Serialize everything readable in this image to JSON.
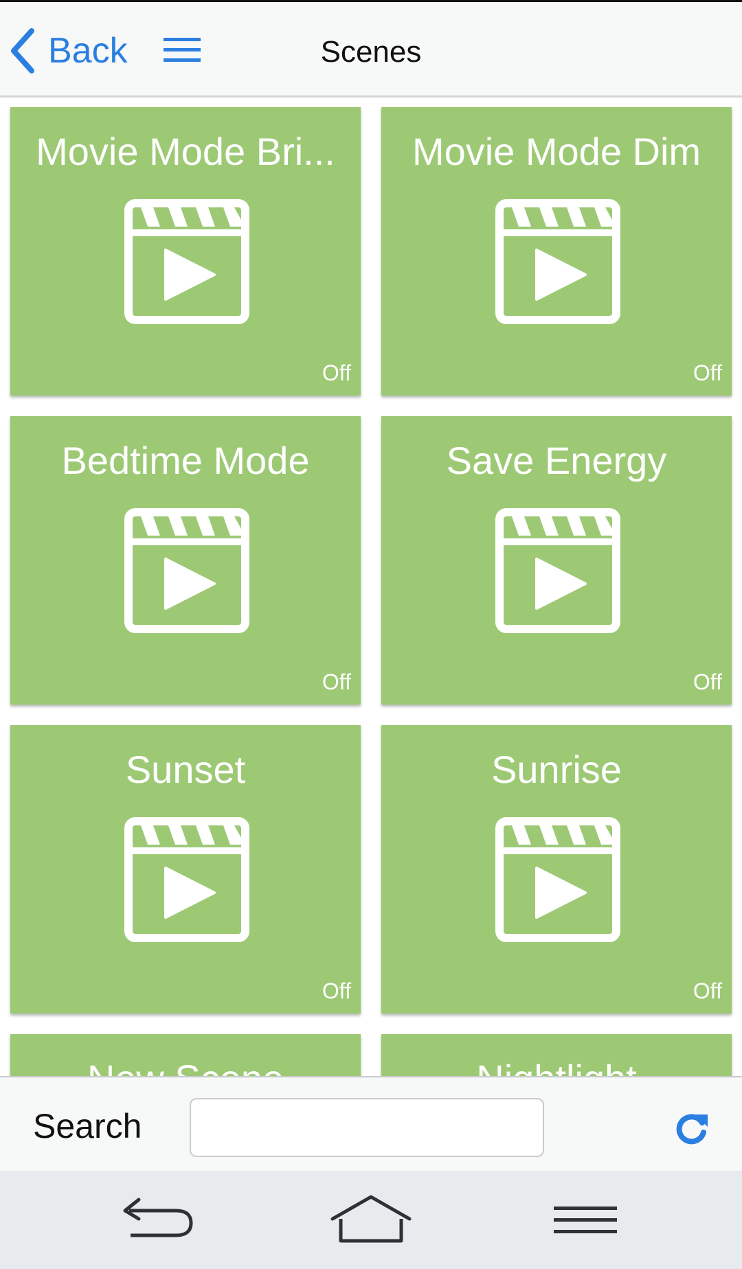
{
  "header": {
    "back_label": "Back",
    "back_icon": "chevron-left-icon",
    "menu_icon": "hamburger-menu-icon",
    "title": "Scenes"
  },
  "colors": {
    "accent": "#2a7fe0",
    "tile": "#9dc975",
    "header_bg": "#f7f8f8",
    "navbar_bg": "#e8ebed"
  },
  "scenes": [
    {
      "name": "Movie Mode Bri...",
      "status": "Off",
      "icon": "clapperboard-play-icon"
    },
    {
      "name": "Movie Mode Dim",
      "status": "Off",
      "icon": "clapperboard-play-icon"
    },
    {
      "name": "Bedtime Mode",
      "status": "Off",
      "icon": "clapperboard-play-icon"
    },
    {
      "name": "Save Energy",
      "status": "Off",
      "icon": "clapperboard-play-icon"
    },
    {
      "name": "Sunset",
      "status": "Off",
      "icon": "clapperboard-play-icon"
    },
    {
      "name": "Sunrise",
      "status": "Off",
      "icon": "clapperboard-play-icon"
    },
    {
      "name": "New Scene",
      "status": "",
      "icon": "clapperboard-play-icon"
    },
    {
      "name": "Nightlight",
      "status": "",
      "icon": "clapperboard-play-icon"
    }
  ],
  "search": {
    "label": "Search",
    "value": "",
    "placeholder": "",
    "refresh_icon": "refresh-icon"
  },
  "system_nav": {
    "back_icon": "return-arrow-icon",
    "home_icon": "home-icon",
    "menu_icon": "menu-lines-icon"
  }
}
